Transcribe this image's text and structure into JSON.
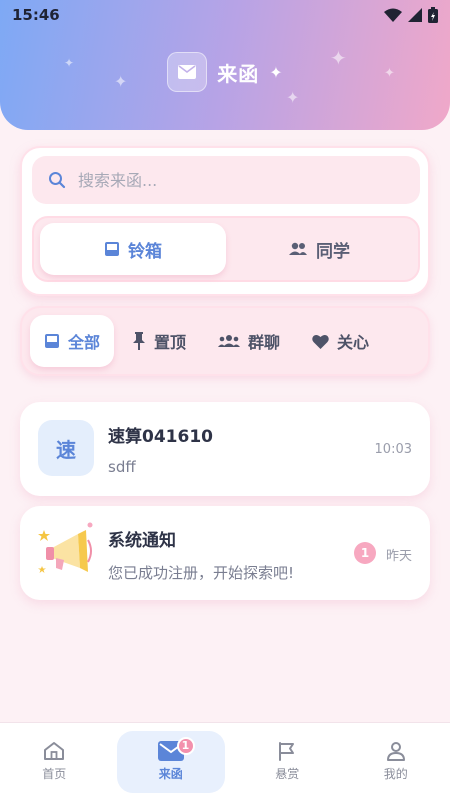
{
  "status_bar": {
    "time": "15:46"
  },
  "header": {
    "title": "来函"
  },
  "search": {
    "placeholder": "搜索来函..."
  },
  "segments": [
    {
      "label": "铃箱",
      "icon": "inbox-icon",
      "active": true
    },
    {
      "label": "同学",
      "icon": "people-icon",
      "active": false
    }
  ],
  "filters": [
    {
      "label": "全部",
      "icon": "inbox-icon",
      "active": true
    },
    {
      "label": "置顶",
      "icon": "pin-icon",
      "active": false
    },
    {
      "label": "群聊",
      "icon": "group-icon",
      "active": false
    },
    {
      "label": "关心",
      "icon": "heart-icon",
      "active": false
    }
  ],
  "messages": [
    {
      "avatar_text": "速",
      "name": "速算041610",
      "preview": "sdff",
      "time": "10:03"
    },
    {
      "avatar_icon": "megaphone-icon",
      "name": "系统通知",
      "preview": "您已成功注册，开始探索吧!",
      "time": "昨天",
      "unread": "1"
    }
  ],
  "tabbar": [
    {
      "label": "首页",
      "icon": "home-icon"
    },
    {
      "label": "来函",
      "icon": "mail-icon",
      "active": true,
      "badge": "1"
    },
    {
      "label": "悬赏",
      "icon": "flag-icon"
    },
    {
      "label": "我的",
      "icon": "user-icon"
    }
  ],
  "colors": {
    "accent": "#5b85d8",
    "pink": "#f7a8c0",
    "background": "#fdf1f5"
  }
}
